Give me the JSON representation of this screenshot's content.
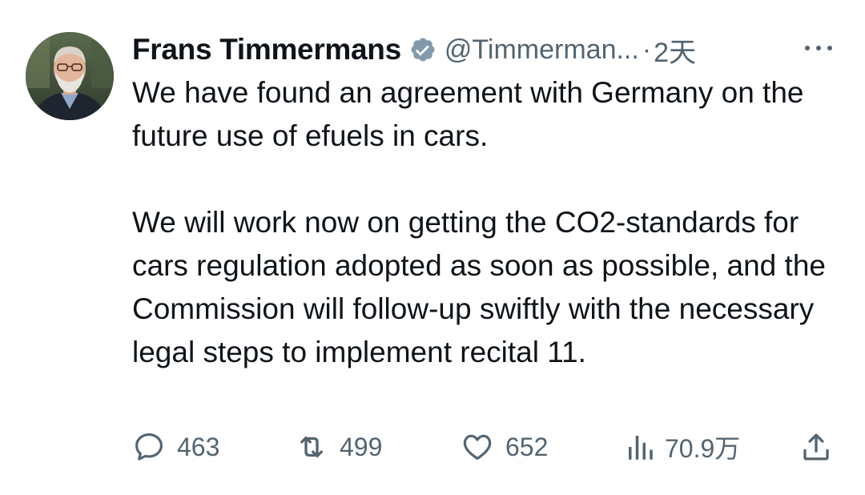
{
  "author": {
    "name": "Frans Timmermans",
    "handle": "@Timmerman...",
    "separator": "·",
    "time": "2天",
    "verified_icon": "verified-badge-icon"
  },
  "tweet": {
    "paragraphs": [
      "We have found an agreement with Germany on the future use of efuels in cars.",
      "We will work now on getting the CO2-standards for cars regulation adopted as soon as possible, and the Commission will follow-up swiftly with the necessary legal steps to implement recital 11."
    ]
  },
  "actions": {
    "replies": "463",
    "retweets": "499",
    "likes": "652",
    "views": "70.9万"
  },
  "colors": {
    "text": "#0f1419",
    "secondary": "#536471",
    "verified": "#829aab"
  }
}
